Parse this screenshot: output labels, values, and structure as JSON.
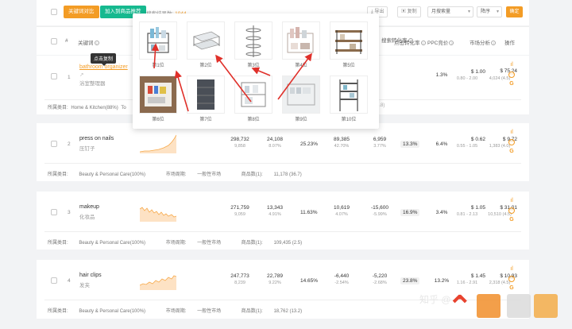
{
  "toolbar": {
    "btn_add_keyword": "关键词对比",
    "btn_add_product": "加入到商品推荐",
    "search_count_label": "搜索结果数: ",
    "search_count_value": "1044",
    "export_label": "导出",
    "copy_label": "复制",
    "sort_field": "月搜索量",
    "sort_order": "降序",
    "confirm_label": "确定"
  },
  "header": {
    "hash": "#",
    "keyword": "关键词",
    "click_rate": "点击转化率",
    "conversion": "搜索转化率",
    "ppc_bid": "PPC竞价",
    "market_analysis": "市场分析",
    "ops": "操作"
  },
  "tooltip": "点击复制",
  "popup": {
    "labels": [
      "第1位",
      "第2位",
      "第3位",
      "第4位",
      "第5位",
      "第6位",
      "第7位",
      "第8位",
      "第9位",
      "第10位"
    ]
  },
  "rows": [
    {
      "index": "1",
      "keyword": "bathroom organizer",
      "translation": "浴室整理器",
      "click_rate": "1.3%",
      "ppc": "$ 1.00",
      "ppc_range": "0.80 - 2.00",
      "market": "$ 75.24",
      "market_sub": "4,024 (4.5)",
      "footer_category_label": "所属类目:",
      "footer_category": "Home & Kitchen(88%)",
      "footer_extra": "To",
      "footer_right": "4.8)"
    },
    {
      "index": "2",
      "keyword": "press on nails",
      "translation": "压钉子",
      "monthly_search": "298,732",
      "monthly_search_sub": "9,858",
      "clicks": "24,108",
      "clicks_pct": "8.07%",
      "share": "25.23%",
      "purchases": "89,385",
      "purchases_pct": "42.70%",
      "change": "6,959",
      "change_pct": "3.77%",
      "pill": "13.3%",
      "click_rate": "6.4%",
      "ppc": "$ 0.62",
      "ppc_range": "0.55 - 1.05",
      "market": "$ 9.72",
      "market_sub": "1,383 (4.0)",
      "footer_category_label": "所属类目:",
      "footer_category": "Beauty & Personal Care(100%)",
      "footer_cycle_label": "市场周期:",
      "footer_cycle": "一般性市场",
      "footer_goods_label": "商品数(1):",
      "footer_goods": "11,178 (36.7)"
    },
    {
      "index": "3",
      "keyword": "makeup",
      "translation": "化妆品",
      "monthly_search": "271,759",
      "monthly_search_sub": "9,059",
      "clicks": "13,343",
      "clicks_pct": "4.91%",
      "share": "11.63%",
      "purchases": "10,619",
      "purchases_pct": "4.07%",
      "change": "-15,600",
      "change_pct": "-5.99%",
      "pill": "16.9%",
      "click_rate": "3.4%",
      "ppc": "$ 1.05",
      "ppc_range": "0.81 - 2.13",
      "market": "$ 31.01",
      "market_sub": "10,510 (4.5)",
      "footer_category_label": "所属类目:",
      "footer_category": "Beauty & Personal Care(100%)",
      "footer_cycle_label": "市场周期:",
      "footer_cycle": "一般性市场",
      "footer_goods_label": "商品数(1):",
      "footer_goods": "109,435 (2.5)"
    },
    {
      "index": "4",
      "keyword": "hair clips",
      "translation": "发夹",
      "monthly_search": "247,773",
      "monthly_search_sub": "8,239",
      "clicks": "22,789",
      "clicks_pct": "9.22%",
      "share": "14.65%",
      "purchases": "-6,440",
      "purchases_pct": "-2.54%",
      "change": "-5,220",
      "change_pct": "-2.68%",
      "pill": "23.8%",
      "click_rate": "13.2%",
      "ppc": "$ 1.45",
      "ppc_range": "1.16 - 2.91",
      "market": "$ 10.93",
      "market_sub": "2,318 (4.5)",
      "footer_category_label": "所属类目:",
      "footer_category": "Beauty & Personal Care(100%)",
      "footer_cycle_label": "市场周期:",
      "footer_cycle": "一般性市场",
      "footer_goods_label": "商品数(1):",
      "footer_goods": "18,762 (13.2)"
    }
  ],
  "watermark": "知乎 @"
}
